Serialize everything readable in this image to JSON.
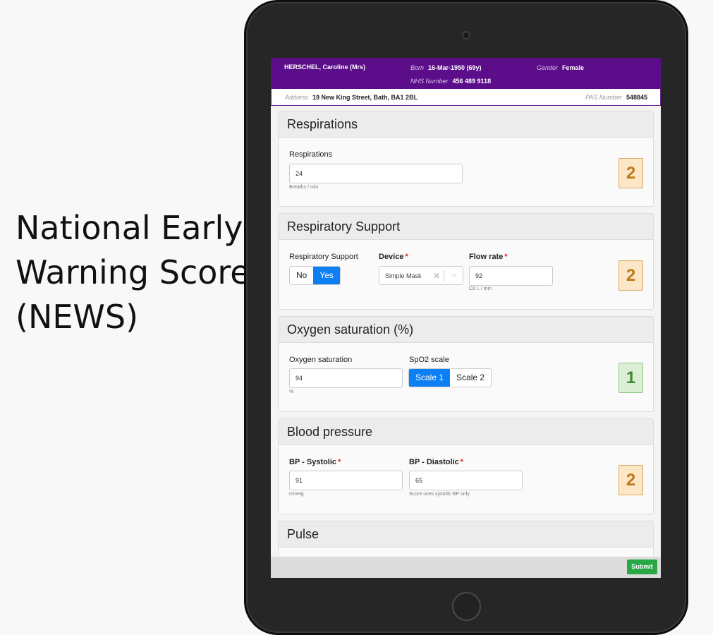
{
  "side_title": [
    "National Early",
    "Warning Score",
    "(NEWS)"
  ],
  "patient": {
    "name": "HERSCHEL, Caroline (Mrs)",
    "born_label": "Born",
    "born_value": "16-Mar-1950 (69y)",
    "gender_label": "Gender",
    "gender_value": "Female",
    "nhs_label": "NHS Number",
    "nhs_value": "456 489 9118",
    "address_label": "Address",
    "address_value": "19 New King Street, Bath, BA1 2BL",
    "pas_label": "PAS Number",
    "pas_value": "548845"
  },
  "sections": {
    "respirations": {
      "title": "Respirations",
      "field_label": "Respirations",
      "value": "24",
      "unit": "Breaths / min",
      "score": "2"
    },
    "respiratory_support": {
      "title": "Respiratory Support",
      "support_label": "Respiratory Support",
      "options": [
        "No",
        "Yes"
      ],
      "selected": "Yes",
      "device_label": "Device",
      "device_value": "Simple Mask",
      "flow_label": "Flow rate",
      "flow_value": "92",
      "flow_unit": "O2 L / min",
      "score": "2"
    },
    "oxygen": {
      "title": "Oxygen saturation (%)",
      "field_label": "Oxygen saturation",
      "value": "94",
      "unit": "%",
      "scale_label": "SpO2 scale",
      "scale_options": [
        "Scale 1",
        "Scale 2"
      ],
      "selected_scale": "Scale 1",
      "score": "1"
    },
    "blood_pressure": {
      "title": "Blood pressure",
      "systolic_label": "BP - Systolic",
      "systolic_value": "91",
      "systolic_unit": "mmHg",
      "diastolic_label": "BP - Diastolic",
      "diastolic_value": "65",
      "diastolic_hint": "Score uses systolic BP only",
      "score": "2"
    },
    "pulse": {
      "title": "Pulse"
    }
  },
  "footer": {
    "submit_label": "Submit"
  },
  "icons": {
    "clear": "close-icon",
    "dropdown": "chevron-down-icon"
  },
  "colors": {
    "banner": "#5c0d8a",
    "primary": "#0d7ff5",
    "submit": "#28a745",
    "score_amber": "#c0781a",
    "score_green": "#3b8c2c"
  }
}
